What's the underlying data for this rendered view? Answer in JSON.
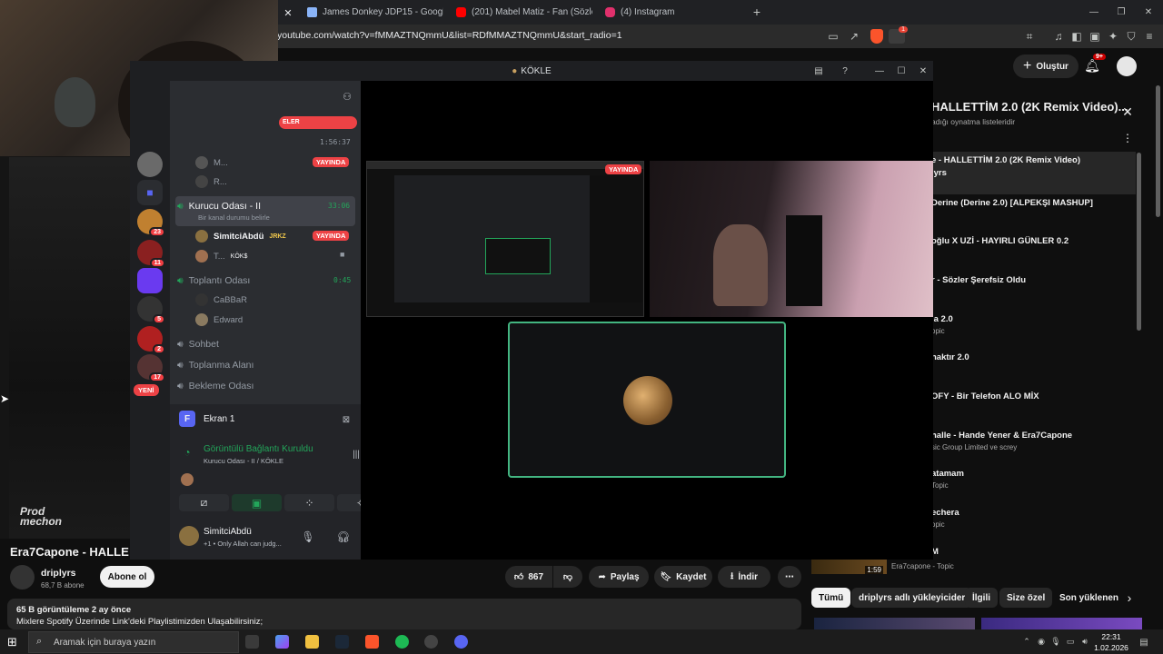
{
  "browser": {
    "tabs": [
      {
        "label": "James Donkey JDP15 - Google Alışve",
        "color": "#8ab4f8"
      },
      {
        "label": "(201) Mabel Matiz - Fan (Sözleri - Lyri",
        "color": "#ff0000"
      },
      {
        "label": "(4) Instagram",
        "color": "#e1306c"
      }
    ],
    "new_tab": "+",
    "url": "youtube.com/watch?v=fMMAZTNQmmU&list=RDfMMAZTNQmmU&start_radio=1",
    "brave_badge": "1"
  },
  "youtube": {
    "create_label": "Oluştur",
    "notif_badge": "9+",
    "watermark": "Prod mechon",
    "video_title": "Era7Capone - HALLET",
    "channel_name": "driplyrs",
    "subscribers": "68,7 B abone",
    "subscribe_label": "Abone ol",
    "like_count": "867",
    "share_label": "Paylaş",
    "save_label": "Kaydet",
    "download_label": "İndir",
    "views_line": "65 B görüntüleme  2 ay önce",
    "desc_line": "Mixlere Spotify Üzerinde Link'deki Playlistimizden Ulaşabilirsiniz;",
    "playlist_title": "HALLETTİM 2.0 (2K Remix Video)...",
    "playlist_sub": "adığı oynatma listeleridir",
    "playlist": [
      {
        "title": "e - HALLETTİM 2.0 (2K Remix Video)",
        "sub": "lyrs"
      },
      {
        "title": "Derine (Derine 2.0) [ALPEKŞI MASHUP]",
        "sub": ""
      },
      {
        "title": "oğlu X UZİ - HAYIRLI GÜNLER 0.2",
        "sub": ""
      },
      {
        "title": "r - Sözler Şerefsiz Oldu",
        "sub": ""
      },
      {
        "title": "la 2.0",
        "sub": "opic"
      },
      {
        "title": "naktır 2.0",
        "sub": ""
      },
      {
        "title": "OFY - Bir Telefon ALO MİX",
        "sub": ""
      },
      {
        "title": "halle - Hande Yener & Era7Capone",
        "sub": "sic Group Limited ve screy"
      },
      {
        "title": "atamam",
        "sub": "Topic"
      },
      {
        "title": "echera",
        "sub": "opic"
      },
      {
        "title": "M",
        "sub": ""
      }
    ],
    "last_item_sub": "Era7capone - Topic",
    "last_item_time": "1:59",
    "chips": [
      "Tümü",
      "driplyrs adlı yükleyicider",
      "İlgili",
      "Size özel",
      "Son yüklenen"
    ]
  },
  "discord": {
    "window_title": "KÖKLE",
    "events_label": "ELER",
    "timer_top": "1:56:37",
    "live_label": "YAYINDA",
    "new_label": "YENİ",
    "server_badges": [
      "23",
      "11",
      "5",
      "2",
      "17"
    ],
    "channels": [
      {
        "name": "Kurucu Odası - II",
        "time": "33:06",
        "status": "Bir kanal durumu belirle"
      },
      {
        "name": "Toplantı Odası",
        "time": "0:45"
      },
      {
        "name": "Sohbet"
      },
      {
        "name": "Toplanma Alanı"
      },
      {
        "name": "Bekleme Odası"
      }
    ],
    "users_top": [
      "M...",
      "R..."
    ],
    "user_simitci": "SimitciAbdü",
    "user_simitci_tag": "JRKZ",
    "user_t": "T...",
    "user_t_tag": "KÖK$",
    "toplanti_users": [
      "CaBBaR",
      "Edward"
    ],
    "screen_label": "Ekran 1",
    "screen_initial": "F",
    "voice_status": "Görüntülü Bağlantı Kuruldu",
    "voice_location": "Kurucu Odası - II / KÖKLE",
    "self_name": "SimitciAbdü",
    "self_status": "+1 • Only Allah can judg..."
  },
  "taskbar": {
    "search_placeholder": "Aramak için buraya yazın",
    "time": "22:31",
    "date": "1.02.2026"
  }
}
